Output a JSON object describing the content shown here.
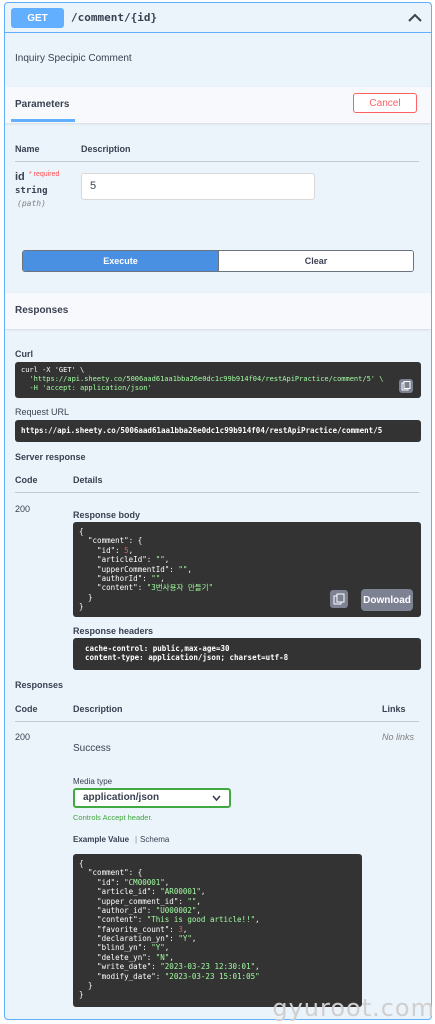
{
  "operation": {
    "method": "GET",
    "path": "/comment/{id}",
    "description": "Inquiry Specipic Comment"
  },
  "parameters": {
    "tab_label": "Parameters",
    "cancel_label": "Cancel",
    "col_name": "Name",
    "col_description": "Description",
    "param": {
      "name": "id",
      "required_mark": "* required",
      "type": "string",
      "location": "(path)",
      "value": "5"
    },
    "execute_label": "Execute",
    "clear_label": "Clear"
  },
  "responses_section": {
    "title": "Responses",
    "curl_label": "Curl",
    "curl_lines": [
      "curl -X 'GET' \\",
      "  'https://api.sheety.co/5006aad61aa1bba26e0dc1c99b914f04/restApiPractice/comment/5' \\",
      "  -H 'accept: application/json'"
    ],
    "request_url_label": "Request URL",
    "request_url": "https://api.sheety.co/5006aad61aa1bba26e0dc1c99b914f04/restApiPractice/comment/5",
    "server_response_label": "Server response",
    "col_code": "Code",
    "col_details": "Details",
    "status_code": "200",
    "response_body_label": "Response body",
    "download_label": "Download",
    "response_headers_label": "Response headers",
    "headers_lines": [
      "cache-control: public,max-age=30",
      "content-type: application/json; charset=utf-8"
    ]
  },
  "response_body": [
    {
      "t": "plain",
      "v": "{"
    },
    {
      "t": "plain",
      "v": "  \"comment\": {"
    },
    {
      "t": "kv",
      "k": "    \"id\": ",
      "v": "5",
      "c": "num",
      "e": ","
    },
    {
      "t": "kv",
      "k": "    \"articleId\": ",
      "v": "\"\"",
      "c": "str",
      "e": ","
    },
    {
      "t": "kv",
      "k": "    \"upperCommentId\": ",
      "v": "\"\"",
      "c": "str",
      "e": ","
    },
    {
      "t": "kv",
      "k": "    \"authorId\": ",
      "v": "\"\"",
      "c": "str",
      "e": ","
    },
    {
      "t": "kv",
      "k": "    \"content\": ",
      "v": "\"3번사용자 만들기\"",
      "c": "str",
      "e": ""
    },
    {
      "t": "plain",
      "v": "  }"
    },
    {
      "t": "plain",
      "v": "}"
    }
  ],
  "documented": {
    "title": "Responses",
    "col_code": "Code",
    "col_description": "Description",
    "col_links": "Links",
    "code": "200",
    "description": "Success",
    "links": "No links",
    "media_type_label": "Media type",
    "media_type": "application/json",
    "controls_note": "Controls Accept header.",
    "example_value_label": "Example Value",
    "schema_label": "Schema"
  },
  "example_body": [
    {
      "t": "plain",
      "v": "{"
    },
    {
      "t": "plain",
      "v": "  \"comment\": {"
    },
    {
      "t": "kv",
      "k": "    \"id\": ",
      "v": "\"CM00001\"",
      "c": "str",
      "e": ","
    },
    {
      "t": "kv",
      "k": "    \"article_id\": ",
      "v": "\"AR00001\"",
      "c": "str",
      "e": ","
    },
    {
      "t": "kv",
      "k": "    \"upper_comment_id\": ",
      "v": "\"\"",
      "c": "str",
      "e": ","
    },
    {
      "t": "kv",
      "k": "    \"author_id\": ",
      "v": "\"U000002\"",
      "c": "str",
      "e": ","
    },
    {
      "t": "kv",
      "k": "    \"content\": ",
      "v": "\"This is good article!!\"",
      "c": "str",
      "e": ","
    },
    {
      "t": "kv",
      "k": "    \"favorite_count\": ",
      "v": "3",
      "c": "num",
      "e": ","
    },
    {
      "t": "kv",
      "k": "    \"declaration_yn\": ",
      "v": "\"Y\"",
      "c": "str",
      "e": ","
    },
    {
      "t": "kv",
      "k": "    \"blind_yn\": ",
      "v": "\"Y\"",
      "c": "str",
      "e": ","
    },
    {
      "t": "kv",
      "k": "    \"delete_yn\": ",
      "v": "\"N\"",
      "c": "str",
      "e": ","
    },
    {
      "t": "kv",
      "k": "    \"write_date\": ",
      "v": "\"2023-03-23 12:30:01\"",
      "c": "str",
      "e": ","
    },
    {
      "t": "kv",
      "k": "    \"modify_date\": ",
      "v": "\"2023-03-23 15:01:05\"",
      "c": "str",
      "e": ""
    },
    {
      "t": "plain",
      "v": "  }"
    },
    {
      "t": "plain",
      "v": "}"
    }
  ],
  "watermark": "gyuroot.com",
  "colors": {
    "get_method": "#61affe",
    "execute": "#4990e2",
    "cancel": "#ff6060",
    "select_border": "#41a940",
    "code_bg": "#333333"
  },
  "icons": [
    "chevron-up-icon",
    "copy-icon"
  ]
}
